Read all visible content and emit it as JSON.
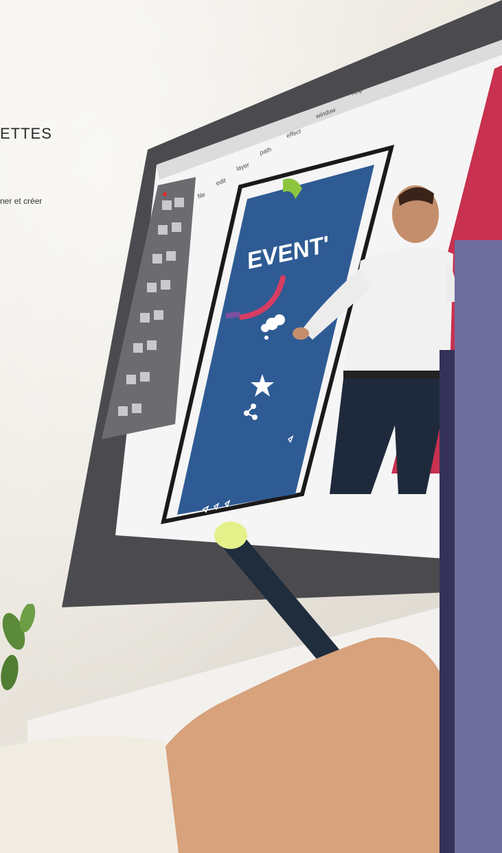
{
  "headline": "ETTES",
  "subline": "ner et créer",
  "menu": [
    "file",
    "edit",
    "layer",
    "path",
    "effect",
    "window",
    "help"
  ],
  "banner_text": "EVENT'",
  "colors": {
    "wall": "#ece9e2",
    "bezel": "#4b4b4f",
    "banner_blue": "#2f5b94",
    "banner_red": "#d63d63",
    "accent_green": "#8cc63f",
    "overlay_light": "#6e6e9e",
    "overlay_dark": "#34325a",
    "stylus": "#1f2d3d",
    "stylus_tip": "#e4f08a"
  },
  "icons": [
    "cloud-icon",
    "star-icon",
    "share-icon"
  ]
}
